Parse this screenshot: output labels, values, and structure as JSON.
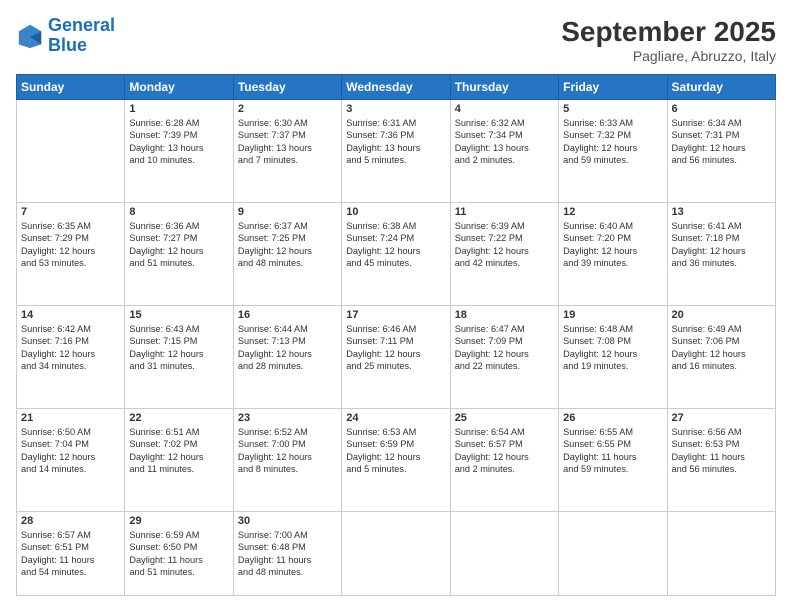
{
  "header": {
    "logo_line1": "General",
    "logo_line2": "Blue",
    "month_year": "September 2025",
    "location": "Pagliare, Abruzzo, Italy"
  },
  "days_of_week": [
    "Sunday",
    "Monday",
    "Tuesday",
    "Wednesday",
    "Thursday",
    "Friday",
    "Saturday"
  ],
  "weeks": [
    [
      {
        "day": "",
        "text": ""
      },
      {
        "day": "1",
        "text": "Sunrise: 6:28 AM\nSunset: 7:39 PM\nDaylight: 13 hours\nand 10 minutes."
      },
      {
        "day": "2",
        "text": "Sunrise: 6:30 AM\nSunset: 7:37 PM\nDaylight: 13 hours\nand 7 minutes."
      },
      {
        "day": "3",
        "text": "Sunrise: 6:31 AM\nSunset: 7:36 PM\nDaylight: 13 hours\nand 5 minutes."
      },
      {
        "day": "4",
        "text": "Sunrise: 6:32 AM\nSunset: 7:34 PM\nDaylight: 13 hours\nand 2 minutes."
      },
      {
        "day": "5",
        "text": "Sunrise: 6:33 AM\nSunset: 7:32 PM\nDaylight: 12 hours\nand 59 minutes."
      },
      {
        "day": "6",
        "text": "Sunrise: 6:34 AM\nSunset: 7:31 PM\nDaylight: 12 hours\nand 56 minutes."
      }
    ],
    [
      {
        "day": "7",
        "text": "Sunrise: 6:35 AM\nSunset: 7:29 PM\nDaylight: 12 hours\nand 53 minutes."
      },
      {
        "day": "8",
        "text": "Sunrise: 6:36 AM\nSunset: 7:27 PM\nDaylight: 12 hours\nand 51 minutes."
      },
      {
        "day": "9",
        "text": "Sunrise: 6:37 AM\nSunset: 7:25 PM\nDaylight: 12 hours\nand 48 minutes."
      },
      {
        "day": "10",
        "text": "Sunrise: 6:38 AM\nSunset: 7:24 PM\nDaylight: 12 hours\nand 45 minutes."
      },
      {
        "day": "11",
        "text": "Sunrise: 6:39 AM\nSunset: 7:22 PM\nDaylight: 12 hours\nand 42 minutes."
      },
      {
        "day": "12",
        "text": "Sunrise: 6:40 AM\nSunset: 7:20 PM\nDaylight: 12 hours\nand 39 minutes."
      },
      {
        "day": "13",
        "text": "Sunrise: 6:41 AM\nSunset: 7:18 PM\nDaylight: 12 hours\nand 36 minutes."
      }
    ],
    [
      {
        "day": "14",
        "text": "Sunrise: 6:42 AM\nSunset: 7:16 PM\nDaylight: 12 hours\nand 34 minutes."
      },
      {
        "day": "15",
        "text": "Sunrise: 6:43 AM\nSunset: 7:15 PM\nDaylight: 12 hours\nand 31 minutes."
      },
      {
        "day": "16",
        "text": "Sunrise: 6:44 AM\nSunset: 7:13 PM\nDaylight: 12 hours\nand 28 minutes."
      },
      {
        "day": "17",
        "text": "Sunrise: 6:46 AM\nSunset: 7:11 PM\nDaylight: 12 hours\nand 25 minutes."
      },
      {
        "day": "18",
        "text": "Sunrise: 6:47 AM\nSunset: 7:09 PM\nDaylight: 12 hours\nand 22 minutes."
      },
      {
        "day": "19",
        "text": "Sunrise: 6:48 AM\nSunset: 7:08 PM\nDaylight: 12 hours\nand 19 minutes."
      },
      {
        "day": "20",
        "text": "Sunrise: 6:49 AM\nSunset: 7:06 PM\nDaylight: 12 hours\nand 16 minutes."
      }
    ],
    [
      {
        "day": "21",
        "text": "Sunrise: 6:50 AM\nSunset: 7:04 PM\nDaylight: 12 hours\nand 14 minutes."
      },
      {
        "day": "22",
        "text": "Sunrise: 6:51 AM\nSunset: 7:02 PM\nDaylight: 12 hours\nand 11 minutes."
      },
      {
        "day": "23",
        "text": "Sunrise: 6:52 AM\nSunset: 7:00 PM\nDaylight: 12 hours\nand 8 minutes."
      },
      {
        "day": "24",
        "text": "Sunrise: 6:53 AM\nSunset: 6:59 PM\nDaylight: 12 hours\nand 5 minutes."
      },
      {
        "day": "25",
        "text": "Sunrise: 6:54 AM\nSunset: 6:57 PM\nDaylight: 12 hours\nand 2 minutes."
      },
      {
        "day": "26",
        "text": "Sunrise: 6:55 AM\nSunset: 6:55 PM\nDaylight: 11 hours\nand 59 minutes."
      },
      {
        "day": "27",
        "text": "Sunrise: 6:56 AM\nSunset: 6:53 PM\nDaylight: 11 hours\nand 56 minutes."
      }
    ],
    [
      {
        "day": "28",
        "text": "Sunrise: 6:57 AM\nSunset: 6:51 PM\nDaylight: 11 hours\nand 54 minutes."
      },
      {
        "day": "29",
        "text": "Sunrise: 6:59 AM\nSunset: 6:50 PM\nDaylight: 11 hours\nand 51 minutes."
      },
      {
        "day": "30",
        "text": "Sunrise: 7:00 AM\nSunset: 6:48 PM\nDaylight: 11 hours\nand 48 minutes."
      },
      {
        "day": "",
        "text": ""
      },
      {
        "day": "",
        "text": ""
      },
      {
        "day": "",
        "text": ""
      },
      {
        "day": "",
        "text": ""
      }
    ]
  ]
}
